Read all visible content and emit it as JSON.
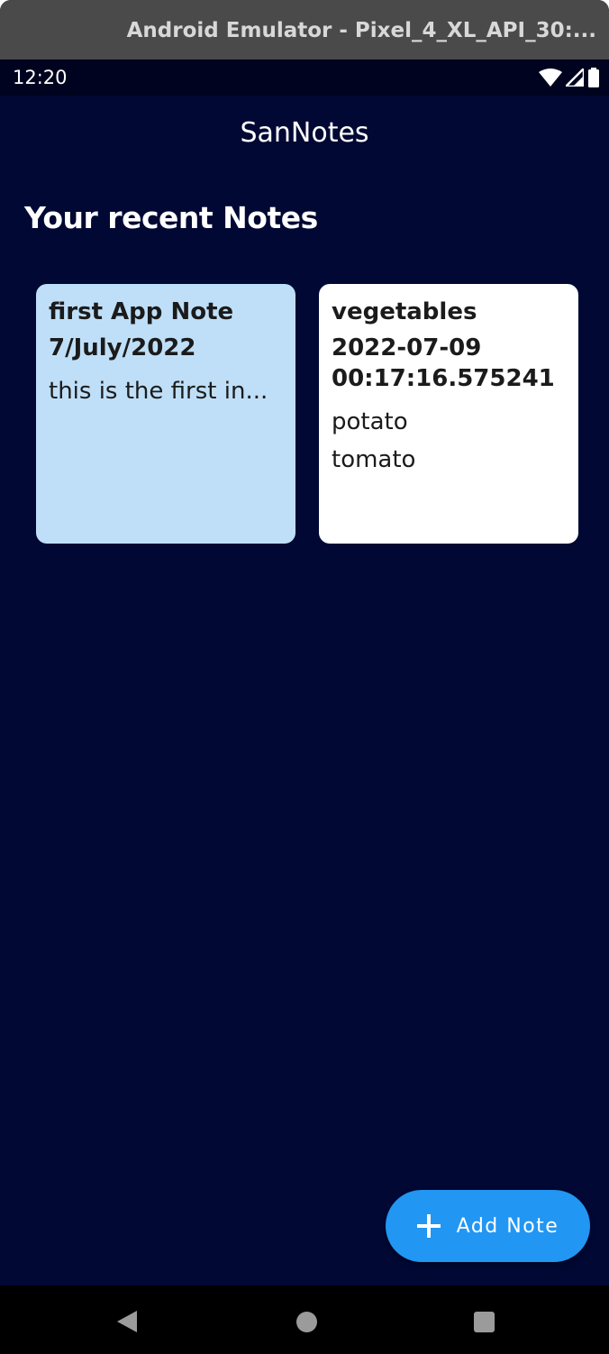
{
  "window": {
    "title": "Android Emulator - Pixel_4_XL_API_30:..."
  },
  "statusbar": {
    "time": "12:20",
    "icons": [
      "wifi-icon",
      "signal-icon",
      "battery-icon"
    ]
  },
  "appbar": {
    "title": "SanNotes"
  },
  "section": {
    "heading": "Your recent Notes"
  },
  "notes": [
    {
      "title": "first App Note",
      "date": "7/July/2022",
      "body": "this is the first in...",
      "color": "#bfdff8"
    },
    {
      "title": "vegetables",
      "date": "2022-07-09\n00:17:16.575241",
      "body": "potato\ntomato",
      "color": "#ffffff"
    }
  ],
  "fab": {
    "label": "Add Note",
    "icon": "plus-icon",
    "color": "#2196f3"
  },
  "navbar": {
    "buttons": [
      "back-icon",
      "home-icon",
      "recents-icon"
    ]
  },
  "colors": {
    "background": "#000833",
    "statusbar": "#00031f",
    "titlebar": "#4a4a4a"
  }
}
